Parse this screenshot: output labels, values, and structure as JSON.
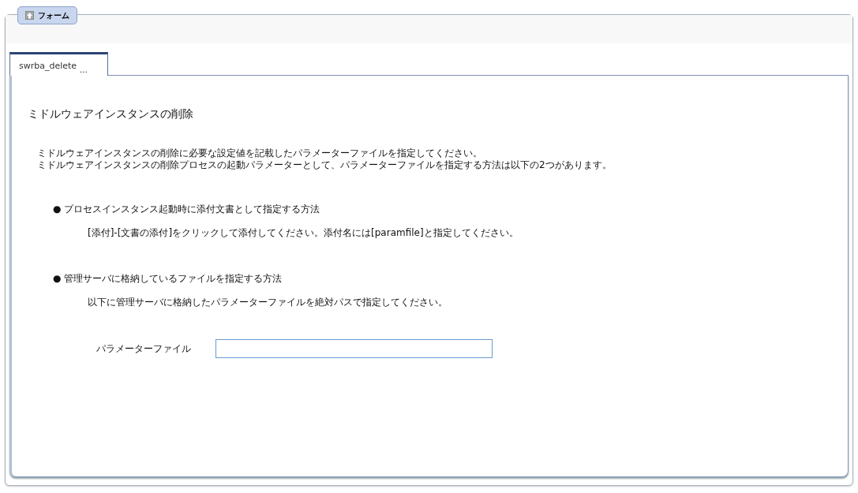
{
  "legend": {
    "label": "フォーム"
  },
  "tabs": [
    {
      "label": "swrba_delete",
      "more": "...",
      "selected": true
    }
  ],
  "form": {
    "title": "ミドルウェアインスタンスの削除",
    "intro": [
      "ミドルウェアインスタンスの削除に必要な設定値を記載したパラメーターファイルを指定してください。",
      "ミドルウェアインスタンスの削除プロセスの起動パラメーターとして、パラメーターファイルを指定する方法は以下の2つがあります。"
    ],
    "methods": [
      {
        "heading": "● プロセスインスタンス起動時に添付文書として指定する方法",
        "detail": "[添付]-[文書の添付]をクリックして添付してください。添付名には[paramfile]と指定してください。"
      },
      {
        "heading": "● 管理サーバに格納しているファイルを指定する方法",
        "detail": "以下に管理サーバに格納したパラメーターファイルを絶対パスで指定してください。"
      }
    ],
    "field": {
      "label": "パラメーターファイル"
    }
  }
}
